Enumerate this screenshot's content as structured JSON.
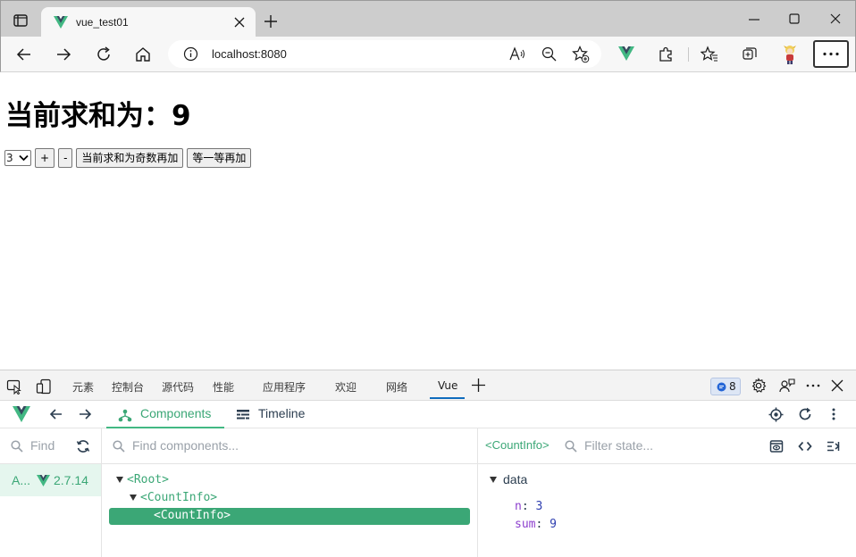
{
  "browser": {
    "tab_title": "vue_test01",
    "url": "localhost:8080"
  },
  "page": {
    "heading_prefix": "当前求和为：",
    "sum": "9",
    "select_value": "3",
    "buttons": {
      "increment": "+",
      "decrement": "-",
      "increment_if_odd": "当前求和为奇数再加",
      "increment_wait": "等一等再加"
    }
  },
  "devtools": {
    "tabs": [
      "元素",
      "控制台",
      "源代码",
      "性能",
      "应用程序",
      "欢迎",
      "网络",
      "Vue"
    ],
    "issues_count": "8",
    "vue": {
      "nav": {
        "components": "Components",
        "timeline": "Timeline"
      },
      "apps_search_placeholder": "Find",
      "app": {
        "name": "A...",
        "version": "2.7.14"
      },
      "tree_search_placeholder": "Find components...",
      "tree": {
        "root": "<Root>",
        "child": "<CountInfo>",
        "selected": "<CountInfo>"
      },
      "state": {
        "component": "<CountInfo>",
        "filter_placeholder": "Filter state...",
        "section": "data",
        "fields": [
          {
            "key": "n",
            "value": "3"
          },
          {
            "key": "sum",
            "value": "9"
          }
        ]
      }
    }
  },
  "colors": {
    "vue_green": "#42b883",
    "vue_dark": "#35495e",
    "selected_row": "#3ba776",
    "edge_accent": "#0f6cbd"
  }
}
